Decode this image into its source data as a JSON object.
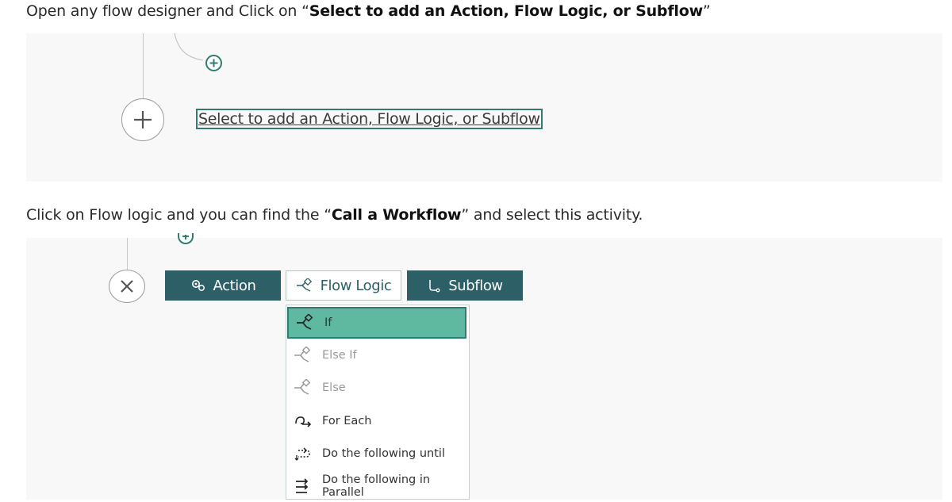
{
  "step1": {
    "text_before": "Open any flow designer and Click on “",
    "text_bold": "Select to add an Action, Flow Logic, or Subflow",
    "text_after": "”"
  },
  "designer": {
    "select_prompt": "Select to add an Action, Flow Logic, or Subflow"
  },
  "step2": {
    "text_before": "Click on Flow logic and you can find the “",
    "text_bold": "Call a Workflow",
    "text_after": "” and select this activity."
  },
  "tabs": {
    "action": {
      "label": "Action",
      "icon": "gears-icon"
    },
    "flow_logic": {
      "label": "Flow Logic",
      "icon": "flow-logic-icon"
    },
    "subflow": {
      "label": "Subflow",
      "icon": "subflow-icon"
    }
  },
  "menu": {
    "items": [
      {
        "label": "If",
        "state": "selected",
        "icon": "branch-icon"
      },
      {
        "label": "Else If",
        "state": "disabled",
        "icon": "branch-icon"
      },
      {
        "label": "Else",
        "state": "disabled",
        "icon": "branch-icon"
      },
      {
        "label": "For Each",
        "state": "enabled",
        "icon": "loop-arrow-icon"
      },
      {
        "label": "Do the following until",
        "state": "enabled",
        "icon": "loop-until-icon"
      },
      {
        "label": "Do the following in Parallel",
        "state": "enabled",
        "icon": "parallel-arrows-icon"
      }
    ]
  },
  "colors": {
    "accent": "#2e7d6e",
    "tab_dark": "#2d5f66",
    "selected_bg": "#5fb8a0"
  }
}
